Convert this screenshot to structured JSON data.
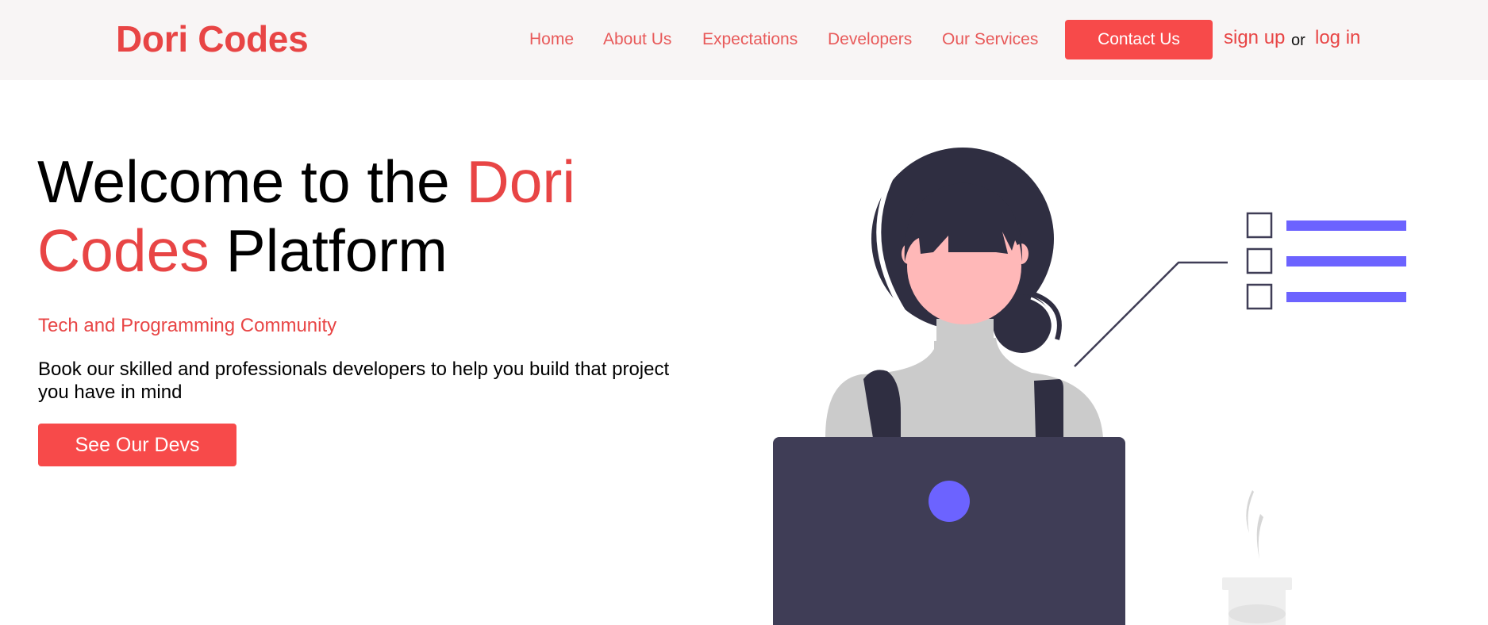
{
  "navbar": {
    "brand": "Dori Codes",
    "links": [
      "Home",
      "About Us",
      "Expectations",
      "Developers",
      "Our Services"
    ],
    "contact_label": "Contact Us",
    "signup_label": "sign up",
    "or_label": "or",
    "login_label": "log in"
  },
  "hero": {
    "title_part1": "Welcome to the ",
    "title_accent": "Dori Codes",
    "title_part2": " Platform",
    "subtitle": "Tech and Programming Community",
    "description": "Book our skilled and professionals developers to help you build that project you have in mind",
    "cta_label": "See Our Devs"
  },
  "colors": {
    "brand_red": "#e84545",
    "button_red": "#f74a4a",
    "navbar_bg": "#f8f5f5",
    "illustration_dark": "#2f2e41",
    "illustration_accent": "#6c63ff",
    "skin": "#ffb8b8",
    "shirt": "#cbcbcb"
  }
}
